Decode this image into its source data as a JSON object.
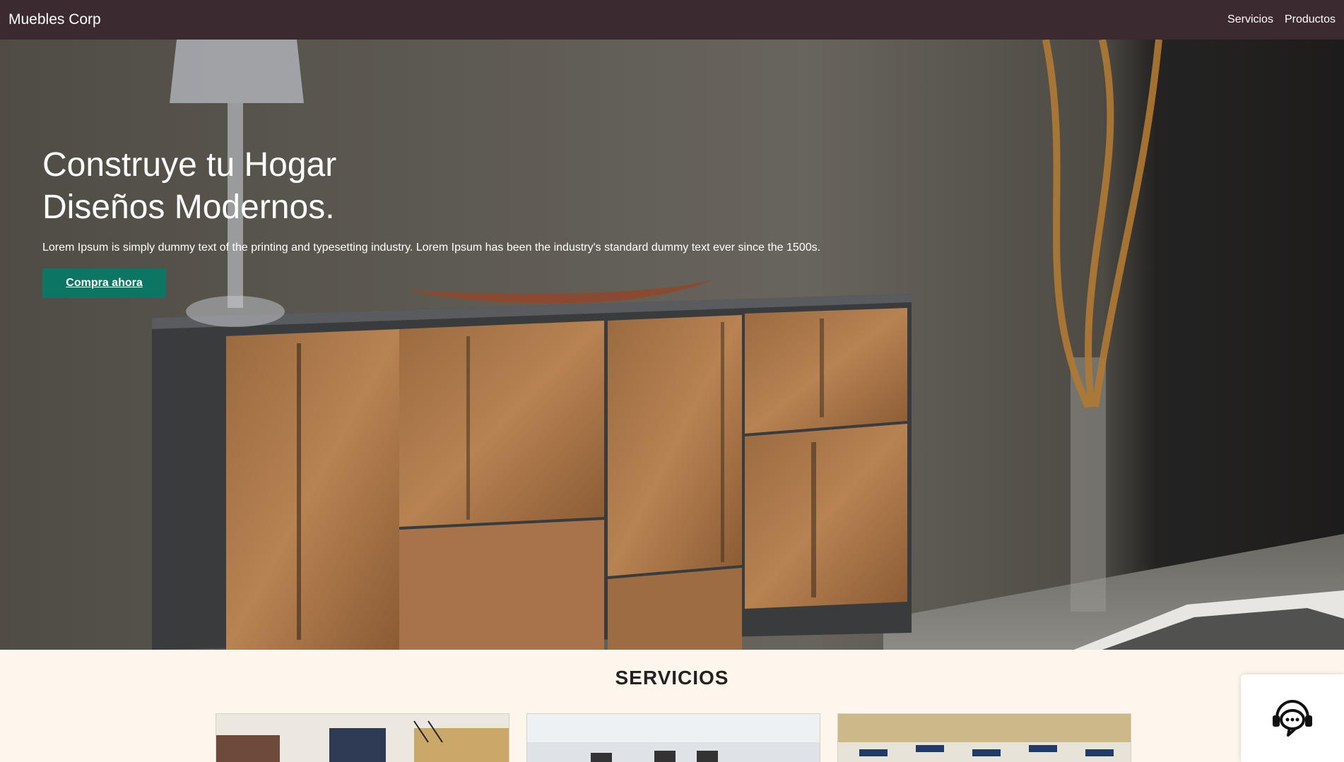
{
  "header": {
    "brand": "Muebles Corp",
    "nav": [
      "Servicios",
      "Productos"
    ]
  },
  "hero": {
    "title_line1": "Construye tu Hogar",
    "title_line2": "Diseños Modernos.",
    "description": "Lorem Ipsum is simply dummy text of the printing and typesetting industry. Lorem Ipsum has been the industry's standard dummy text ever since the 1500s.",
    "cta_label": "Compra ahora"
  },
  "services": {
    "title": "SERVICIOS"
  },
  "colors": {
    "header_bg": "#3b2a2f",
    "cta_bg": "#0d7564",
    "section_bg": "#fdf6ec"
  },
  "icons": {
    "chat": "support-chat-icon"
  }
}
